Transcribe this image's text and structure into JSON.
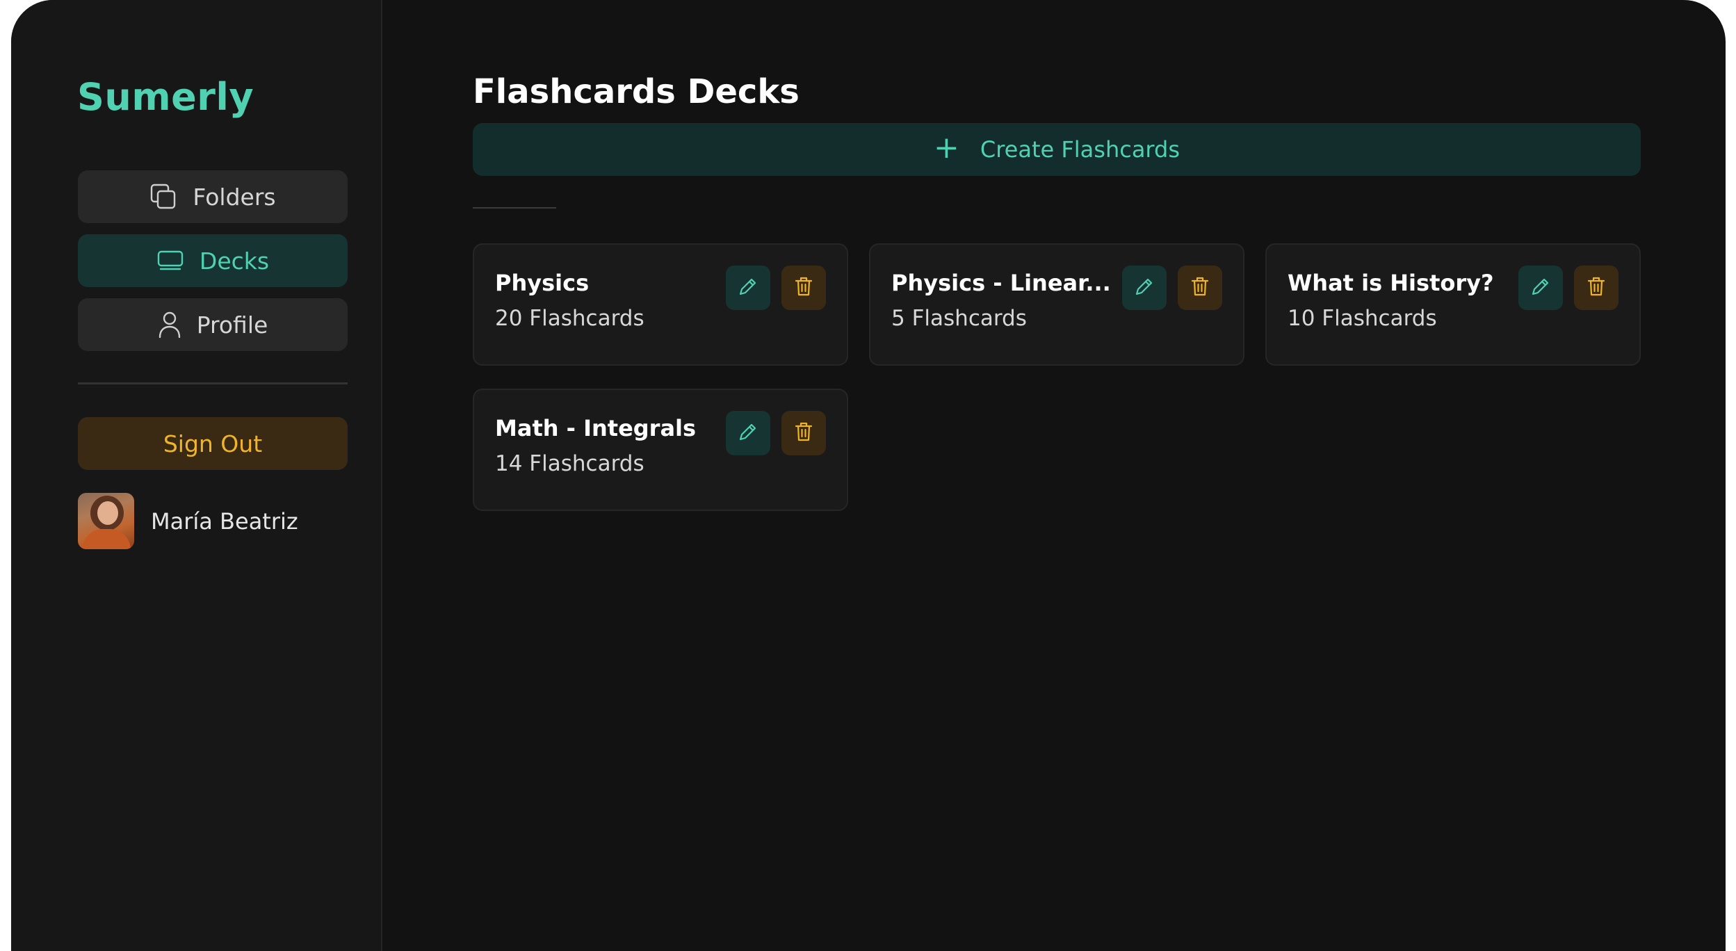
{
  "app": {
    "brand": "Sumerly"
  },
  "sidebar": {
    "items": [
      {
        "label": "Folders",
        "icon": "folders-icon",
        "active": false
      },
      {
        "label": "Decks",
        "icon": "deck-icon",
        "active": true
      },
      {
        "label": "Profile",
        "icon": "user-icon",
        "active": false
      }
    ],
    "signout_label": "Sign Out",
    "user": {
      "name": "María Beatriz"
    }
  },
  "main": {
    "title": "Flashcards Decks",
    "create_label": "Create Flashcards",
    "decks": [
      {
        "title": "Physics",
        "count": "20 Flashcards"
      },
      {
        "title": "Physics - Linear...",
        "count": "5 Flashcards"
      },
      {
        "title": "What is History?",
        "count": "10 Flashcards"
      },
      {
        "title": "Math - Integrals",
        "count": "14 Flashcards"
      }
    ]
  },
  "colors": {
    "accent": "#4fd1b2",
    "warning": "#f0b429",
    "background": "#121212",
    "sidebar": "#171717"
  }
}
